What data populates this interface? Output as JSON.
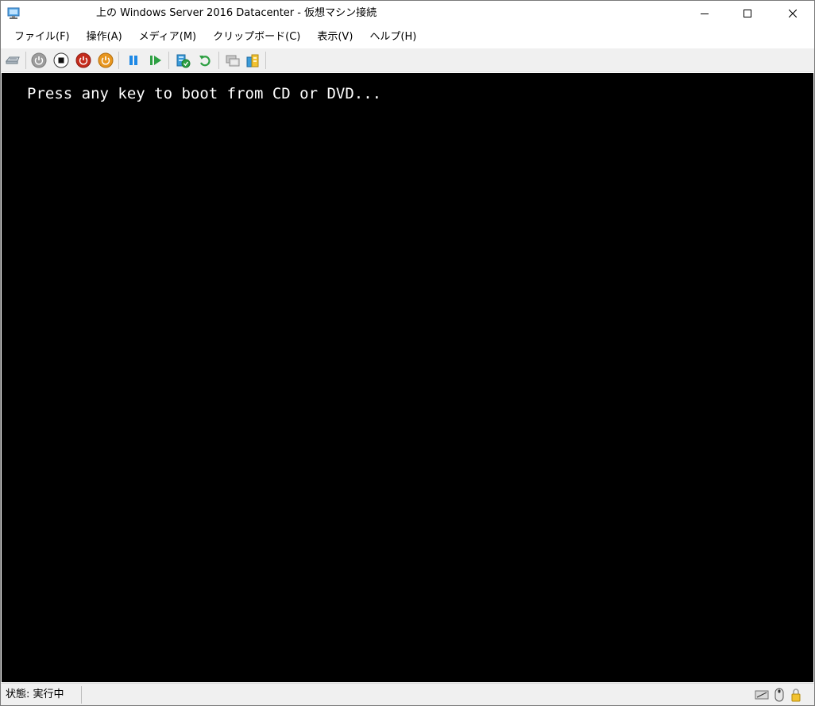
{
  "window": {
    "title": "上の Windows Server 2016 Datacenter  - 仮想マシン接続"
  },
  "menu": {
    "items": [
      "ファイル(F)",
      "操作(A)",
      "メディア(M)",
      "クリップボード(C)",
      "表示(V)",
      "ヘルプ(H)"
    ]
  },
  "toolbar": {
    "icons": [
      "ctrl-alt-del-icon",
      "start-icon",
      "turn-off-icon",
      "shut-down-icon",
      "save-icon",
      "pause-icon",
      "resume-icon",
      "checkpoint-icon",
      "revert-icon",
      "enhanced-session-icon",
      "share-icon"
    ]
  },
  "screen": {
    "boot_message": "Press any key to boot from CD or DVD..."
  },
  "statusbar": {
    "status": "状態: 実行中"
  },
  "colors": {
    "toolbar_bg": "#f0f0f0",
    "screen_bg": "#000000",
    "red_stop": "#c42b1c",
    "orange_save": "#e8961e",
    "blue_pause": "#1e88e5",
    "green_resume": "#2ea043"
  }
}
